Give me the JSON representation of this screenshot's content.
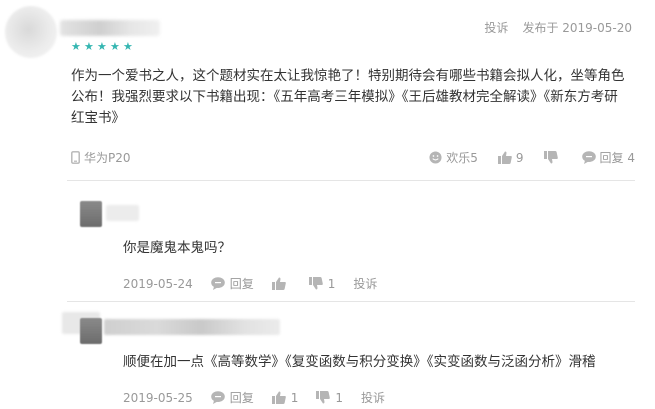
{
  "comment": {
    "rating_stars": 5,
    "report_label": "投诉",
    "published": "发布于 2019-05-20",
    "text": "作为一个爱书之人，这个题材实在太让我惊艳了！特别期待会有哪些书籍会拟人化，坐等角色公布！我强烈要求以下书籍出现：《五年高考三年模拟》《王后雄教材完全解读》《新东方考研红宝书》",
    "device": "华为P20",
    "happy_label": "欢乐5",
    "like_count": "9",
    "dislike_label": "",
    "reply_label": "回复 4"
  },
  "replies": [
    {
      "text": "你是魔鬼本鬼吗？",
      "date": "2019-05-24",
      "reply_label": "回复",
      "like_count": "",
      "dislike_count": "1",
      "report_label": "投诉"
    },
    {
      "text": "顺便在加一点《高等数学》《复变函数与积分变换》《实变函数与泛函分析》滑稽",
      "date": "2019-05-25",
      "reply_label": "回复",
      "like_count": "1",
      "dislike_count": "1",
      "report_label": "投诉"
    }
  ],
  "colors": {
    "star": "#35b6b1",
    "muted_text": "#999999",
    "body_text": "#333333",
    "icon_gray": "#b5b5b5"
  }
}
